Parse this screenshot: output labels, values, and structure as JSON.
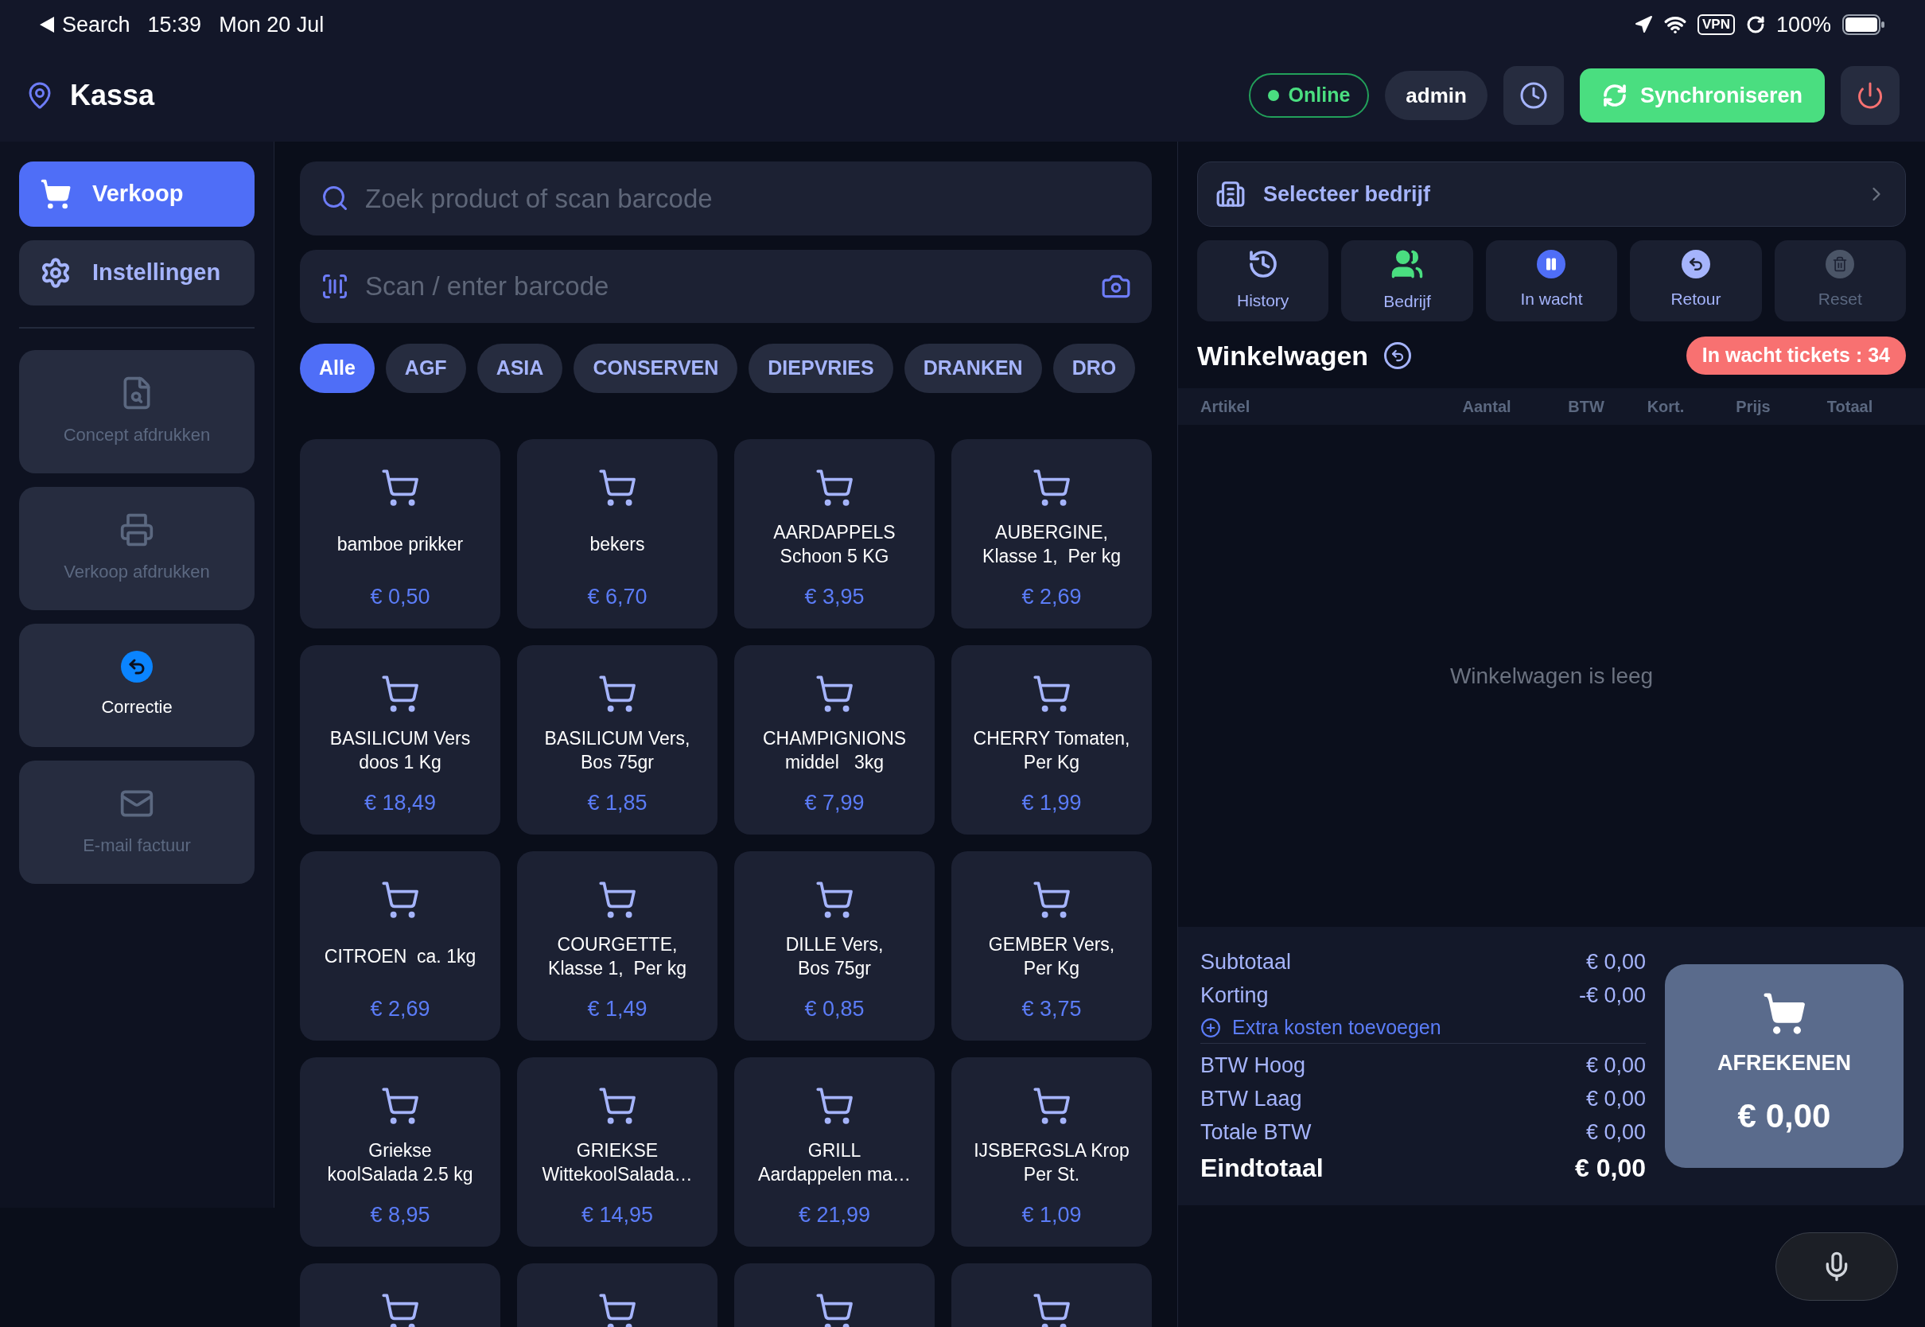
{
  "status_bar": {
    "back_label": "Search",
    "time": "15:39",
    "date": "Mon 20 Jul",
    "vpn": "VPN",
    "battery": "100%"
  },
  "header": {
    "title": "Kassa",
    "status": {
      "label": "Online",
      "online": true
    },
    "user": "admin",
    "sync_button": "Synchroniseren"
  },
  "sidebar": {
    "nav": [
      {
        "kind": "cart",
        "label": "Verkoop",
        "selected": true
      },
      {
        "kind": "gear",
        "label": "Instellingen",
        "selected": false
      }
    ],
    "actions": [
      {
        "kind": "document",
        "label": "Concept afdrukken",
        "disabled": true
      },
      {
        "kind": "printer",
        "label": "Verkoop afdrukken",
        "disabled": true
      },
      {
        "kind": "undo",
        "label": "Correctie",
        "disabled": false
      },
      {
        "kind": "mail",
        "label": "E-mail factuur",
        "disabled": true
      }
    ]
  },
  "search": {
    "placeholder": "Zoek product of scan barcode"
  },
  "barcode": {
    "placeholder": "Scan / enter barcode"
  },
  "categories": [
    {
      "label": "Alle",
      "selected": true
    },
    {
      "label": "AGF",
      "selected": false
    },
    {
      "label": "ASIA",
      "selected": false
    },
    {
      "label": "CONSERVEN",
      "selected": false
    },
    {
      "label": "DIEPVRIES",
      "selected": false
    },
    {
      "label": "DRANKEN",
      "selected": false
    },
    {
      "label": "DRO",
      "selected": false
    }
  ],
  "products": [
    {
      "kind": "full",
      "name": "bamboe prikker",
      "price": "€ 0,50"
    },
    {
      "kind": "full",
      "name": "bekers",
      "price": "€ 6,70"
    },
    {
      "kind": "full",
      "name": "AARDAPPELS\nSchoon 5 KG",
      "price": "€ 3,95"
    },
    {
      "kind": "full",
      "name": "AUBERGINE,\nKlasse 1,  Per kg",
      "price": "€ 2,69"
    },
    {
      "kind": "full",
      "name": "BASILICUM Vers\ndoos 1 Kg",
      "price": "€ 18,49"
    },
    {
      "kind": "full",
      "name": "BASILICUM Vers,\nBos 75gr",
      "price": "€ 1,85"
    },
    {
      "kind": "full",
      "name": "CHAMPIGNIONS\nmiddel   3kg",
      "price": "€ 7,99"
    },
    {
      "kind": "full",
      "name": "CHERRY Tomaten,\nPer Kg",
      "price": "€ 1,99"
    },
    {
      "kind": "full",
      "name": "CITROEN  ca. 1kg",
      "price": "€ 2,69"
    },
    {
      "kind": "full",
      "name": "COURGETTE,\nKlasse 1,  Per kg",
      "price": "€ 1,49"
    },
    {
      "kind": "full",
      "name": "DILLE Vers,\nBos 75gr",
      "price": "€ 0,85"
    },
    {
      "kind": "full",
      "name": "GEMBER Vers,\nPer Kg",
      "price": "€ 3,75"
    },
    {
      "kind": "full",
      "name": "Griekse\nkoolSalada 2.5 kg",
      "price": "€ 8,95"
    },
    {
      "kind": "full",
      "name": "GRIEKSE\nWittekoolSalada…",
      "price": "€ 14,95"
    },
    {
      "kind": "full",
      "name": "GRILL\nAardappelen ma…",
      "price": "€ 21,99"
    },
    {
      "kind": "full",
      "name": "IJSBERGSLA Krop\nPer St.",
      "price": "€ 1,09"
    },
    {
      "kind": "partial"
    },
    {
      "kind": "partial"
    },
    {
      "kind": "partial"
    },
    {
      "kind": "partial"
    }
  ],
  "company": {
    "label": "Selecteer bedrijf"
  },
  "cart_actions": [
    {
      "kind": "history",
      "label": "History",
      "disabled": false
    },
    {
      "kind": "people",
      "label": "Bedrijf",
      "disabled": false
    },
    {
      "kind": "pause",
      "label": "In wacht",
      "disabled": false
    },
    {
      "kind": "undo",
      "label": "Retour",
      "disabled": false
    },
    {
      "kind": "trash",
      "label": "Reset",
      "disabled": true
    }
  ],
  "cart": {
    "title": "Winkelwagen",
    "waiting_badge": "In wacht tickets : 34",
    "columns": [
      "Artikel",
      "Aantal",
      "BTW",
      "Kort.",
      "Prijs",
      "Totaal"
    ],
    "empty_message": "Winkelwagen is leeg"
  },
  "totals": {
    "rows": [
      {
        "label": "Subtotaal",
        "value": "€ 0,00"
      },
      {
        "label": "Korting",
        "value": "-€ 0,00"
      }
    ],
    "extra_link": "Extra kosten toevoegen",
    "tax_rows": [
      {
        "label": "BTW Hoog",
        "value": "€ 0,00"
      },
      {
        "label": "BTW Laag",
        "value": "€ 0,00"
      },
      {
        "label": "Totale BTW",
        "value": "€ 0,00"
      }
    ],
    "grand_total": {
      "label": "Eindtotaal",
      "value": "€ 0,00"
    }
  },
  "checkout": {
    "label": "AFREKENEN",
    "amount": "€ 0,00"
  }
}
